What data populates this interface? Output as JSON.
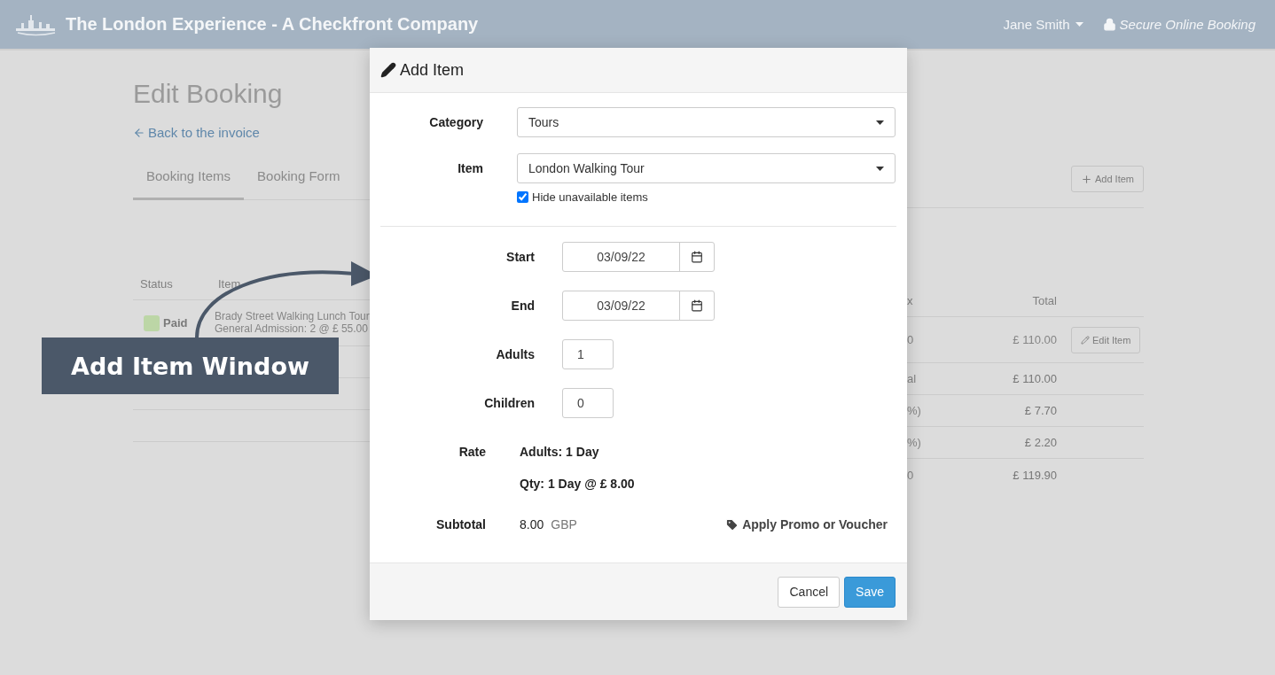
{
  "navbar": {
    "title": "The London Experience - A Checkfront Company",
    "user": "Jane Smith",
    "secure": "Secure Online Booking"
  },
  "page": {
    "heading": "Edit Booking",
    "back_link": "Back to the invoice",
    "add_button": "Add Item",
    "tabs": [
      {
        "label": "Booking Items",
        "selected": true
      },
      {
        "label": "Booking Form",
        "selected": false
      }
    ]
  },
  "table_left": {
    "columns": [
      "Status",
      "Item"
    ],
    "rows": [
      {
        "status": "Paid",
        "item": "Brady Street Walking Lunch Tour",
        "detail": "General Admission: 2 @ £ 55.00"
      }
    ]
  },
  "table_right": {
    "columns": [
      "x",
      "Total"
    ],
    "rows": [
      {
        "column_1": "0",
        "total": "£ 110.00",
        "action": "Edit Item"
      },
      {
        "column_1": "al",
        "total": "£ 110.00"
      },
      {
        "column_1": "%)",
        "total": "£ 7.70"
      },
      {
        "column_1": "%)",
        "total": "£ 2.20"
      },
      {
        "column_1": "0",
        "total": "£ 119.90"
      }
    ]
  },
  "modal": {
    "title": "Add Item",
    "category": {
      "label": "Category",
      "value": "Tours"
    },
    "item": {
      "label": "Item",
      "value": "London Walking Tour"
    },
    "hide_unavailable": {
      "label": "Hide unavailable items",
      "checked": true
    },
    "dates": [
      {
        "label": "Start",
        "value": "03/09/22"
      },
      {
        "label": "End",
        "value": "03/09/22"
      }
    ],
    "counts": [
      {
        "label": "Adults",
        "value": "1"
      },
      {
        "label": "Children",
        "value": "0"
      }
    ],
    "rate": {
      "label": "Rate",
      "lines": [
        "Adults: 1 Day",
        "Qty: 1 Day @ £ 8.00"
      ]
    },
    "subtotal": {
      "label": "Subtotal",
      "amount": "8.00",
      "currency": "GBP",
      "promo": "Apply Promo or Voucher"
    },
    "buttons": {
      "cancel": "Cancel",
      "save": "Save"
    }
  },
  "callout": "Add Item Window"
}
